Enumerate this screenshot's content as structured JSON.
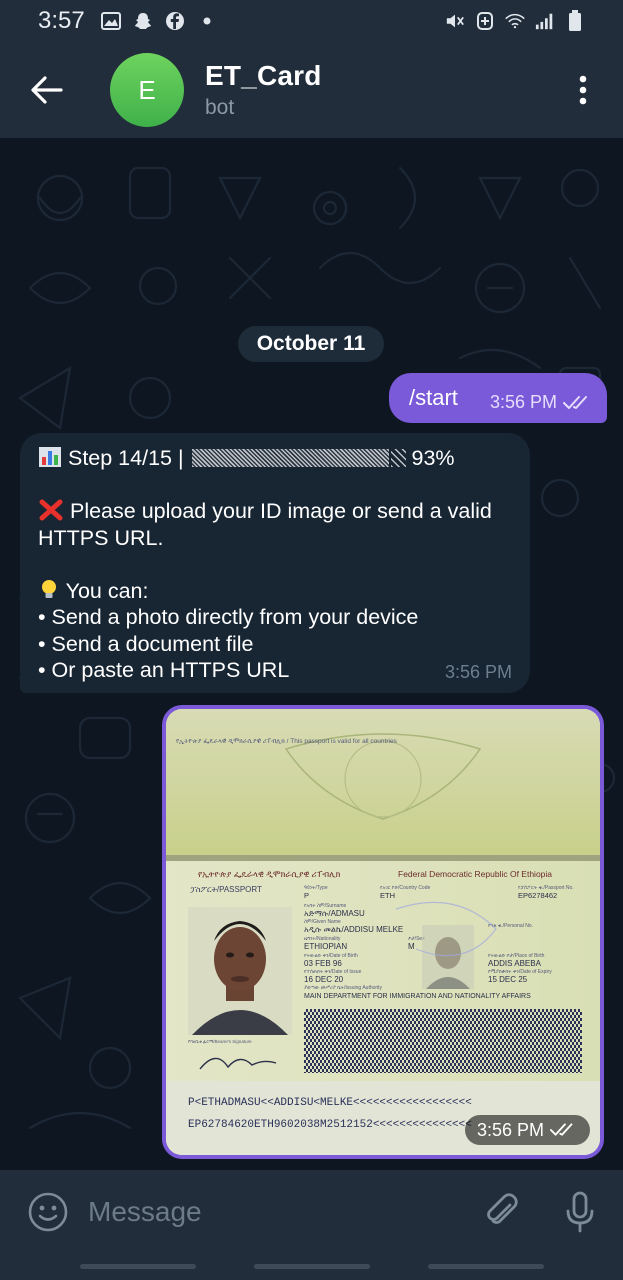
{
  "status_bar": {
    "time": "3:57",
    "left_icons": [
      "gallery-icon",
      "snapchat-icon",
      "facebook-icon",
      "dot-icon"
    ],
    "right_icons": [
      "mute-icon",
      "data-saver-icon",
      "wifi-icon",
      "signal-icon",
      "battery-icon"
    ]
  },
  "header": {
    "avatar_letter": "E",
    "title": "ET_Card",
    "subtitle": "bot",
    "accent_color": "#5cc45a"
  },
  "chat": {
    "date_separator": "October 11",
    "messages": [
      {
        "type": "outgoing_text",
        "text": "/start",
        "time": "3:56 PM",
        "status": "read"
      },
      {
        "type": "incoming_text",
        "step_label": "Step 14/15 |",
        "progress_percent_label": "93%",
        "progress": 0.93,
        "error_line1": "Please upload your ID image or send a valid",
        "error_line2": "HTTPS URL.",
        "tip_heading": "You can:",
        "options": [
          "• Send a photo directly from your device",
          "• Send a document file",
          "• Or paste an HTTPS URL"
        ],
        "time": "3:56 PM"
      },
      {
        "type": "outgoing_photo",
        "time": "3:56 PM",
        "status": "read",
        "photo": {
          "top_text": "የኢትዮጵያ ፌዴራላዊ ዲሞክራሲያዊ ሪፐብሊክ / This passport is valid for all countries",
          "country_amharic": "የኢትዮጵያ ፌዴራላዊ ዲሞክራሲያዊ ሪፐብሊክ",
          "country_english": "Federal Democratic Republic Of Ethiopia",
          "doc_label": "ፓስፖርት/PASSPORT",
          "type_label": "ዓይነት/Type",
          "type_value": "P",
          "code_label": "የአገር ኮድ/Country Code",
          "code_value": "ETH",
          "no_label": "የፓስፖርት ቁ./Passport No.",
          "no_value": "EP6278462",
          "surname_label": "የአባት ስም/Surname",
          "surname_value": "አድማሱ/ADMASU",
          "given_label": "ስም/Given Name",
          "given_value": "አዲሱ መልኬ/ADDISU MELKE",
          "nationality_label": "ዜግነት/Nationality",
          "nationality_value": "ETHIOPIAN",
          "sex_label": "ፆታ/Sex",
          "sex_value": "M",
          "personal_label": "የግል ቁ./Personal No.",
          "dob_label": "የትውልድ ቀን/Date of Birth",
          "dob_value": "03 FEB 96",
          "pob_label": "የትውልድ ቦታ/Place of Birth",
          "pob_value": "ADDIS ABEBA",
          "issue_label": "የተሰጠበት ቀን/Date of Issue",
          "issue_value": "16 DEC 20",
          "expiry_label": "የሚያበቃበት ቀን/Date of Expiry",
          "expiry_value": "15 DEC 25",
          "authority_label": "ያወጣው መሥሪያ ቤት/Issuing Authority",
          "authority_value": "MAIN DEPARTMENT FOR IMMIGRATION AND NATIONALITY AFFAIRS",
          "signature_label": "የባለቤቱ ፊርማ/Bearer's Signature",
          "mrz_line1": "P<ETHADMASU<<ADDISU<MELKE<<<<<<<<<<<<<<<<<<",
          "mrz_line2": "EP62784620ETH9602038M2512152<<<<<<<<<<<<<<<"
        }
      }
    ]
  },
  "input": {
    "placeholder": "Message"
  },
  "colors": {
    "outgoing_bubble": "#7a5ad8",
    "incoming_bubble": "#182533",
    "background": "#0e1621",
    "header": "#212d3b"
  }
}
